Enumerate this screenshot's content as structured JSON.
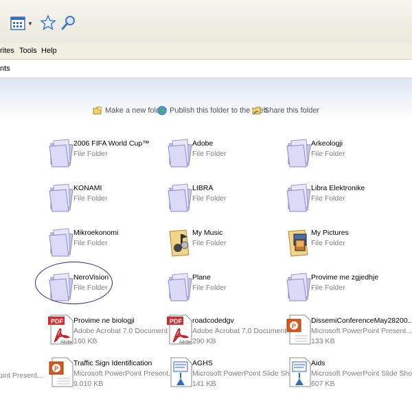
{
  "menu": {
    "favorites_partial": "rites",
    "tools": "Tools",
    "help": "Help"
  },
  "address": {
    "text_partial": "nts"
  },
  "tasks": {
    "make_folder": "Make a new folder",
    "publish": "Publish this folder to the Web",
    "share": "Share this folder"
  },
  "items": [
    {
      "name": "2006 FIFA World Cup™",
      "type": "File Folder",
      "size": "",
      "icon": "folder-icon"
    },
    {
      "name": "Adobe",
      "type": "File Folder",
      "size": "",
      "icon": "folder-icon"
    },
    {
      "name": "Arkeologji",
      "type": "File Folder",
      "size": "",
      "icon": "folder-icon"
    },
    {
      "name": "KONAMI",
      "type": "File Folder",
      "size": "",
      "icon": "folder-icon"
    },
    {
      "name": "LIBRA",
      "type": "File Folder",
      "size": "",
      "icon": "folder-icon"
    },
    {
      "name": "Libra Elektronike",
      "type": "File Folder",
      "size": "",
      "icon": "folder-icon"
    },
    {
      "name": "Mikroekonomi",
      "type": "File Folder",
      "size": "",
      "icon": "folder-icon"
    },
    {
      "name": "My Music",
      "type": "File Folder",
      "size": "",
      "icon": "music-folder-icon"
    },
    {
      "name": "My Pictures",
      "type": "File Folder",
      "size": "",
      "icon": "pictures-folder-icon"
    },
    {
      "name": "NeroVision",
      "type": "File Folder",
      "size": "",
      "icon": "folder-icon"
    },
    {
      "name": "Plane",
      "type": "File Folder",
      "size": "",
      "icon": "folder-icon"
    },
    {
      "name": "Provime me zgjedhje",
      "type": "File Folder",
      "size": "",
      "icon": "folder-icon"
    },
    {
      "name": "Provime ne biologji",
      "type": "Adobe Acrobat 7.0 Document",
      "size": "160 KB",
      "icon": "pdf-icon"
    },
    {
      "name": "roadcodedgv",
      "type": "Adobe Acrobat 7.0 Document",
      "size": "290 KB",
      "icon": "pdf-icon"
    },
    {
      "name": "DissemiConferenceMay28200...",
      "type": "Microsoft PowerPoint Present...",
      "size": "133 KB",
      "icon": "powerpoint-icon"
    },
    {
      "name": "Traffic Sign Identification",
      "type": "Microsoft PowerPoint Present...",
      "size": "9.010 KB",
      "icon": "powerpoint-icon"
    },
    {
      "name": "AGHS",
      "type": "Microsoft PowerPoint Slide Show",
      "size": "141 KB",
      "icon": "slideshow-icon"
    },
    {
      "name": "Aids",
      "type": "Microsoft PowerPoint Slide Show",
      "size": "607 KB",
      "icon": "slideshow-icon"
    }
  ],
  "partial_item_type": "oint Present..."
}
